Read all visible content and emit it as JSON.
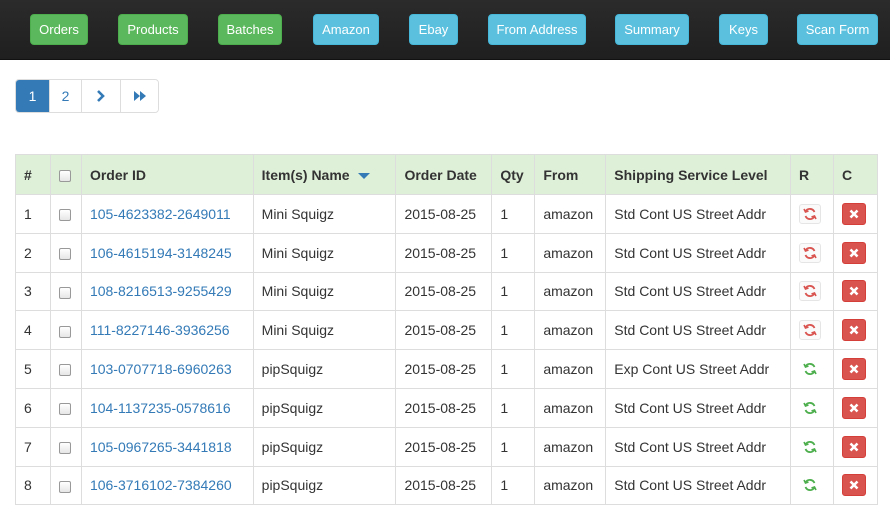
{
  "nav": [
    {
      "label": "Orders",
      "style": "green"
    },
    {
      "label": "Products",
      "style": "green"
    },
    {
      "label": "Batches",
      "style": "green"
    },
    {
      "label": "Amazon",
      "style": "blue"
    },
    {
      "label": "Ebay",
      "style": "blue"
    },
    {
      "label": "From Address",
      "style": "blue"
    },
    {
      "label": "Summary",
      "style": "blue"
    },
    {
      "label": "Keys",
      "style": "blue"
    },
    {
      "label": "Scan Form",
      "style": "blue"
    }
  ],
  "pagination": {
    "pages": [
      "1",
      "2"
    ],
    "current": "1",
    "next_icon": "chevron-right-icon",
    "last_icon": "fast-forward-icon"
  },
  "table": {
    "headers": {
      "num": "#",
      "order_id": "Order ID",
      "item_name": "Item(s) Name",
      "order_date": "Order Date",
      "qty": "Qty",
      "from": "From",
      "shipping": "Shipping Service Level",
      "r": "R",
      "c": "C"
    },
    "sort_column": "item_name",
    "rows": [
      {
        "num": "1",
        "order_id": "105-4623382-2649011",
        "item": "Mini Squigz",
        "date": "2015-08-25",
        "qty": "1",
        "from": "amazon",
        "shipping": "Std Cont US Street Addr",
        "r_status": "red"
      },
      {
        "num": "2",
        "order_id": "106-4615194-3148245",
        "item": "Mini Squigz",
        "date": "2015-08-25",
        "qty": "1",
        "from": "amazon",
        "shipping": "Std Cont US Street Addr",
        "r_status": "red"
      },
      {
        "num": "3",
        "order_id": "108-8216513-9255429",
        "item": "Mini Squigz",
        "date": "2015-08-25",
        "qty": "1",
        "from": "amazon",
        "shipping": "Std Cont US Street Addr",
        "r_status": "red"
      },
      {
        "num": "4",
        "order_id": "111-8227146-3936256",
        "item": "Mini Squigz",
        "date": "2015-08-25",
        "qty": "1",
        "from": "amazon",
        "shipping": "Std Cont US Street Addr",
        "r_status": "red"
      },
      {
        "num": "5",
        "order_id": "103-0707718-6960263",
        "item": "pipSquigz",
        "date": "2015-08-25",
        "qty": "1",
        "from": "amazon",
        "shipping": "Exp Cont US Street Addr",
        "r_status": "green"
      },
      {
        "num": "6",
        "order_id": "104-1137235-0578616",
        "item": "pipSquigz",
        "date": "2015-08-25",
        "qty": "1",
        "from": "amazon",
        "shipping": "Std Cont US Street Addr",
        "r_status": "green"
      },
      {
        "num": "7",
        "order_id": "105-0967265-3441818",
        "item": "pipSquigz",
        "date": "2015-08-25",
        "qty": "1",
        "from": "amazon",
        "shipping": "Std Cont US Street Addr",
        "r_status": "green"
      },
      {
        "num": "8",
        "order_id": "106-3716102-7384260",
        "item": "pipSquigz",
        "date": "2015-08-25",
        "qty": "1",
        "from": "amazon",
        "shipping": "Std Cont US Street Addr",
        "r_status": "green"
      }
    ]
  },
  "colors": {
    "green_button": "#5cb85c",
    "blue_button": "#5bc0de",
    "header_bg": "#dff0d8",
    "link": "#337ab7",
    "danger": "#d9534f",
    "refresh_red": "#d9534f",
    "refresh_green": "#4cae4c"
  }
}
